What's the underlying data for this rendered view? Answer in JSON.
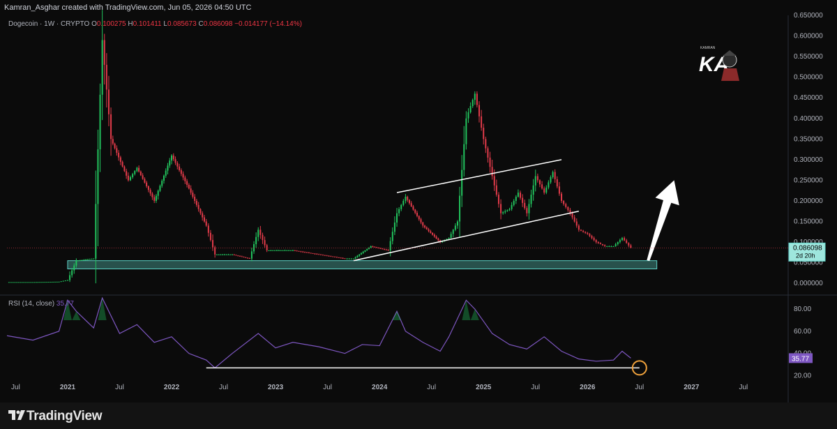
{
  "header": {
    "attribution": "Kamran_Asghar created with TradingView.com, Jun 05, 2026 04:50 UTC"
  },
  "legend": {
    "symbol": "Dogecoin · 1W · CRYPTO",
    "open_label": "O",
    "open": "0.100275",
    "high_label": "H",
    "high": "0.101411",
    "low_label": "L",
    "low": "0.085673",
    "close_label": "C",
    "close": "0.086098",
    "change": "−0.014177 (−14.14%)"
  },
  "price_tag": {
    "value": "0.086098",
    "countdown": "2d 20h"
  },
  "rsi": {
    "label": "RSI (14, close)",
    "value": "35.77",
    "tag": "35.77"
  },
  "footer": {
    "brand": "TradingView"
  },
  "logo": {
    "text": "KA",
    "subtext": "KAMRAN"
  },
  "colors": {
    "background": "#0b0b0b",
    "up": "#22c55e",
    "down": "#e23b4a",
    "support_zone": "#5fd3c7",
    "rsi_line": "#7e57c2",
    "trendline": "#ffffff",
    "highlight_circle": "#f0a23c"
  },
  "chart_data": [
    {
      "type": "candlestick",
      "title": "Dogecoin · 1W · CRYPTO",
      "yscale": "linear",
      "ylim": [
        -0.02,
        0.65
      ],
      "y_ticks": [
        "0.650000",
        "0.600000",
        "0.550000",
        "0.500000",
        "0.450000",
        "0.400000",
        "0.350000",
        "0.300000",
        "0.250000",
        "0.200000",
        "0.150000",
        "0.100000",
        "0.050000",
        "0.000000"
      ],
      "x_ticks": [
        "Jul",
        "2021",
        "Jul",
        "2022",
        "Jul",
        "2023",
        "Jul",
        "2024",
        "Jul",
        "2025",
        "Jul",
        "2026",
        "Jul",
        "2027",
        "Jul"
      ],
      "series": [
        {
          "name": "Dogecoin",
          "x": [
            "2020-06",
            "2020-09",
            "2020-12",
            "2021-01",
            "2021-02",
            "2021-04",
            "2021-05",
            "2021-06",
            "2021-08",
            "2021-09",
            "2021-11",
            "2022-01",
            "2022-03",
            "2022-05",
            "2022-06",
            "2022-08",
            "2022-10",
            "2022-11",
            "2022-12",
            "2023-03",
            "2023-06",
            "2023-09",
            "2023-10",
            "2023-12",
            "2024-02",
            "2024-03",
            "2024-04",
            "2024-06",
            "2024-08",
            "2024-09",
            "2024-10",
            "2024-11",
            "2024-12",
            "2025-01",
            "2025-02",
            "2025-03",
            "2025-04",
            "2025-05",
            "2025-06",
            "2025-07",
            "2025-08",
            "2025-09",
            "2025-10",
            "2025-11",
            "2025-12",
            "2026-01",
            "2026-02",
            "2026-03",
            "2026-04",
            "2026-05",
            "2026-06"
          ],
          "values": [
            0.003,
            0.003,
            0.004,
            0.008,
            0.055,
            0.06,
            0.59,
            0.35,
            0.25,
            0.28,
            0.2,
            0.31,
            0.23,
            0.14,
            0.07,
            0.07,
            0.06,
            0.13,
            0.08,
            0.08,
            0.07,
            0.06,
            0.06,
            0.09,
            0.08,
            0.17,
            0.21,
            0.14,
            0.1,
            0.11,
            0.15,
            0.4,
            0.46,
            0.35,
            0.26,
            0.17,
            0.18,
            0.22,
            0.17,
            0.26,
            0.22,
            0.27,
            0.2,
            0.17,
            0.13,
            0.12,
            0.1,
            0.09,
            0.09,
            0.11,
            0.086
          ]
        }
      ],
      "annotations": [
        {
          "type": "support_zone",
          "from": "2021-01",
          "to": "2026-09",
          "y_range": [
            0.035,
            0.055
          ]
        },
        {
          "type": "channel_upper",
          "from_x": "2024-03",
          "from_y": 0.22,
          "to_x": "2025-10",
          "to_y": 0.3
        },
        {
          "type": "channel_lower",
          "from_x": "2023-10",
          "from_y": 0.055,
          "to_x": "2025-12",
          "to_y": 0.175
        },
        {
          "type": "arrow",
          "from_x": "2026-08",
          "from_y": 0.055,
          "to_x": "2026-11",
          "to_y": 0.25
        }
      ]
    },
    {
      "type": "line",
      "title": "RSI (14, close)",
      "ylim": [
        14,
        92
      ],
      "y_ticks": [
        "80.00",
        "60.00",
        "40.00",
        "20.00"
      ],
      "series": [
        {
          "name": "RSI (14, close)",
          "x": [
            "2020-06",
            "2020-09",
            "2020-12",
            "2021-01",
            "2021-02",
            "2021-04",
            "2021-05",
            "2021-07",
            "2021-09",
            "2021-11",
            "2022-01",
            "2022-03",
            "2022-05",
            "2022-06",
            "2022-08",
            "2022-11",
            "2023-01",
            "2023-03",
            "2023-06",
            "2023-09",
            "2023-11",
            "2024-01",
            "2024-03",
            "2024-04",
            "2024-06",
            "2024-08",
            "2024-09",
            "2024-11",
            "2024-12",
            "2025-02",
            "2025-04",
            "2025-06",
            "2025-08",
            "2025-10",
            "2025-12",
            "2026-02",
            "2026-04",
            "2026-05",
            "2026-06"
          ],
          "values": [
            56,
            52,
            60,
            88,
            78,
            63,
            90,
            58,
            66,
            50,
            55,
            40,
            34,
            27,
            40,
            58,
            45,
            50,
            46,
            40,
            48,
            47,
            78,
            60,
            50,
            42,
            55,
            88,
            80,
            58,
            48,
            44,
            55,
            42,
            35,
            33,
            34,
            42,
            35.77
          ]
        }
      ],
      "annotations": [
        {
          "type": "horizontal_line",
          "from": "2022-05",
          "to": "2026-07",
          "y": 27
        },
        {
          "type": "circle",
          "x": "2026-07",
          "y": 27
        }
      ]
    }
  ]
}
